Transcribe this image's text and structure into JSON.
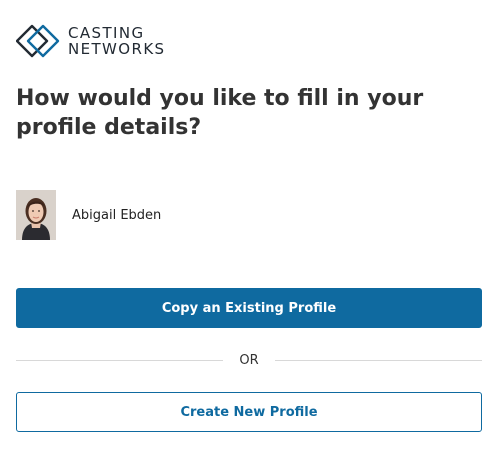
{
  "brand": {
    "line1": "CASTING",
    "line2": "NETWORKS",
    "accent_color": "#0f6aa0"
  },
  "heading": "How would you like to fill in your profile details?",
  "profile": {
    "name": "Abigail Ebden",
    "avatar_icon": "profile-photo"
  },
  "actions": {
    "copy_label": "Copy an Existing Profile",
    "separator": "OR",
    "create_label": "Create New Profile"
  }
}
